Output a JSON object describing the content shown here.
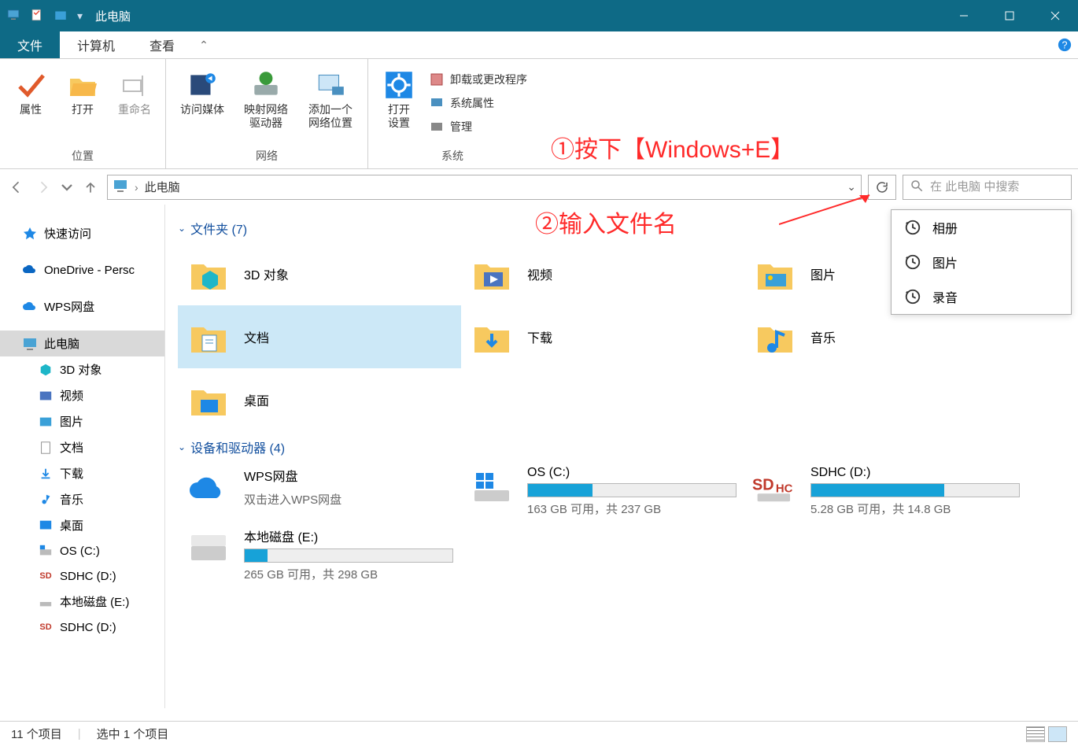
{
  "window": {
    "title": "此电脑"
  },
  "tabs": {
    "file": "文件",
    "computer": "计算机",
    "view": "查看"
  },
  "ribbon": {
    "location": {
      "group": "位置",
      "properties": "属性",
      "open": "打开",
      "rename": "重命名"
    },
    "network": {
      "group": "网络",
      "media": "访问媒体",
      "map": "映射网络\n驱动器",
      "addloc": "添加一个\n网络位置"
    },
    "system": {
      "group": "系统",
      "opensettings": "打开\n设置",
      "uninstall": "卸载或更改程序",
      "sysprops": "系统属性",
      "manage": "管理"
    }
  },
  "nav": {
    "crumb": "此电脑"
  },
  "search": {
    "placeholder": "在 此电脑 中搜索"
  },
  "suggestions": [
    "相册",
    "图片",
    "录音"
  ],
  "tree": {
    "quick": "快速访问",
    "onedrive": "OneDrive - Persc",
    "wps": "WPS网盘",
    "thispc": "此电脑",
    "children": [
      "3D 对象",
      "视频",
      "图片",
      "文档",
      "下载",
      "音乐",
      "桌面",
      "OS (C:)",
      "SDHC (D:)",
      "本地磁盘 (E:)",
      "SDHC (D:)"
    ]
  },
  "content": {
    "folders_hdr": "文件夹 (7)",
    "folders": [
      "3D 对象",
      "视频",
      "图片",
      "文档",
      "下载",
      "音乐",
      "桌面"
    ],
    "drives_hdr": "设备和驱动器 (4)",
    "drives": [
      {
        "name": "WPS网盘",
        "sub": "双击进入WPS网盘",
        "fill": 0,
        "nobar": true,
        "icon": "cloud"
      },
      {
        "name": "OS (C:)",
        "sub": "163 GB 可用，共 237 GB",
        "fill": 31,
        "icon": "win"
      },
      {
        "name": "SDHC (D:)",
        "sub": "5.28 GB 可用，共 14.8 GB",
        "fill": 64,
        "icon": "sd"
      },
      {
        "name": "本地磁盘 (E:)",
        "sub": "265 GB 可用，共 298 GB",
        "fill": 11,
        "icon": "hdd"
      }
    ]
  },
  "status": {
    "items": "11 个项目",
    "selected": "选中 1 个项目"
  },
  "annotations": {
    "step1": "①按下【Windows+E】",
    "step2": "②输入文件名"
  }
}
